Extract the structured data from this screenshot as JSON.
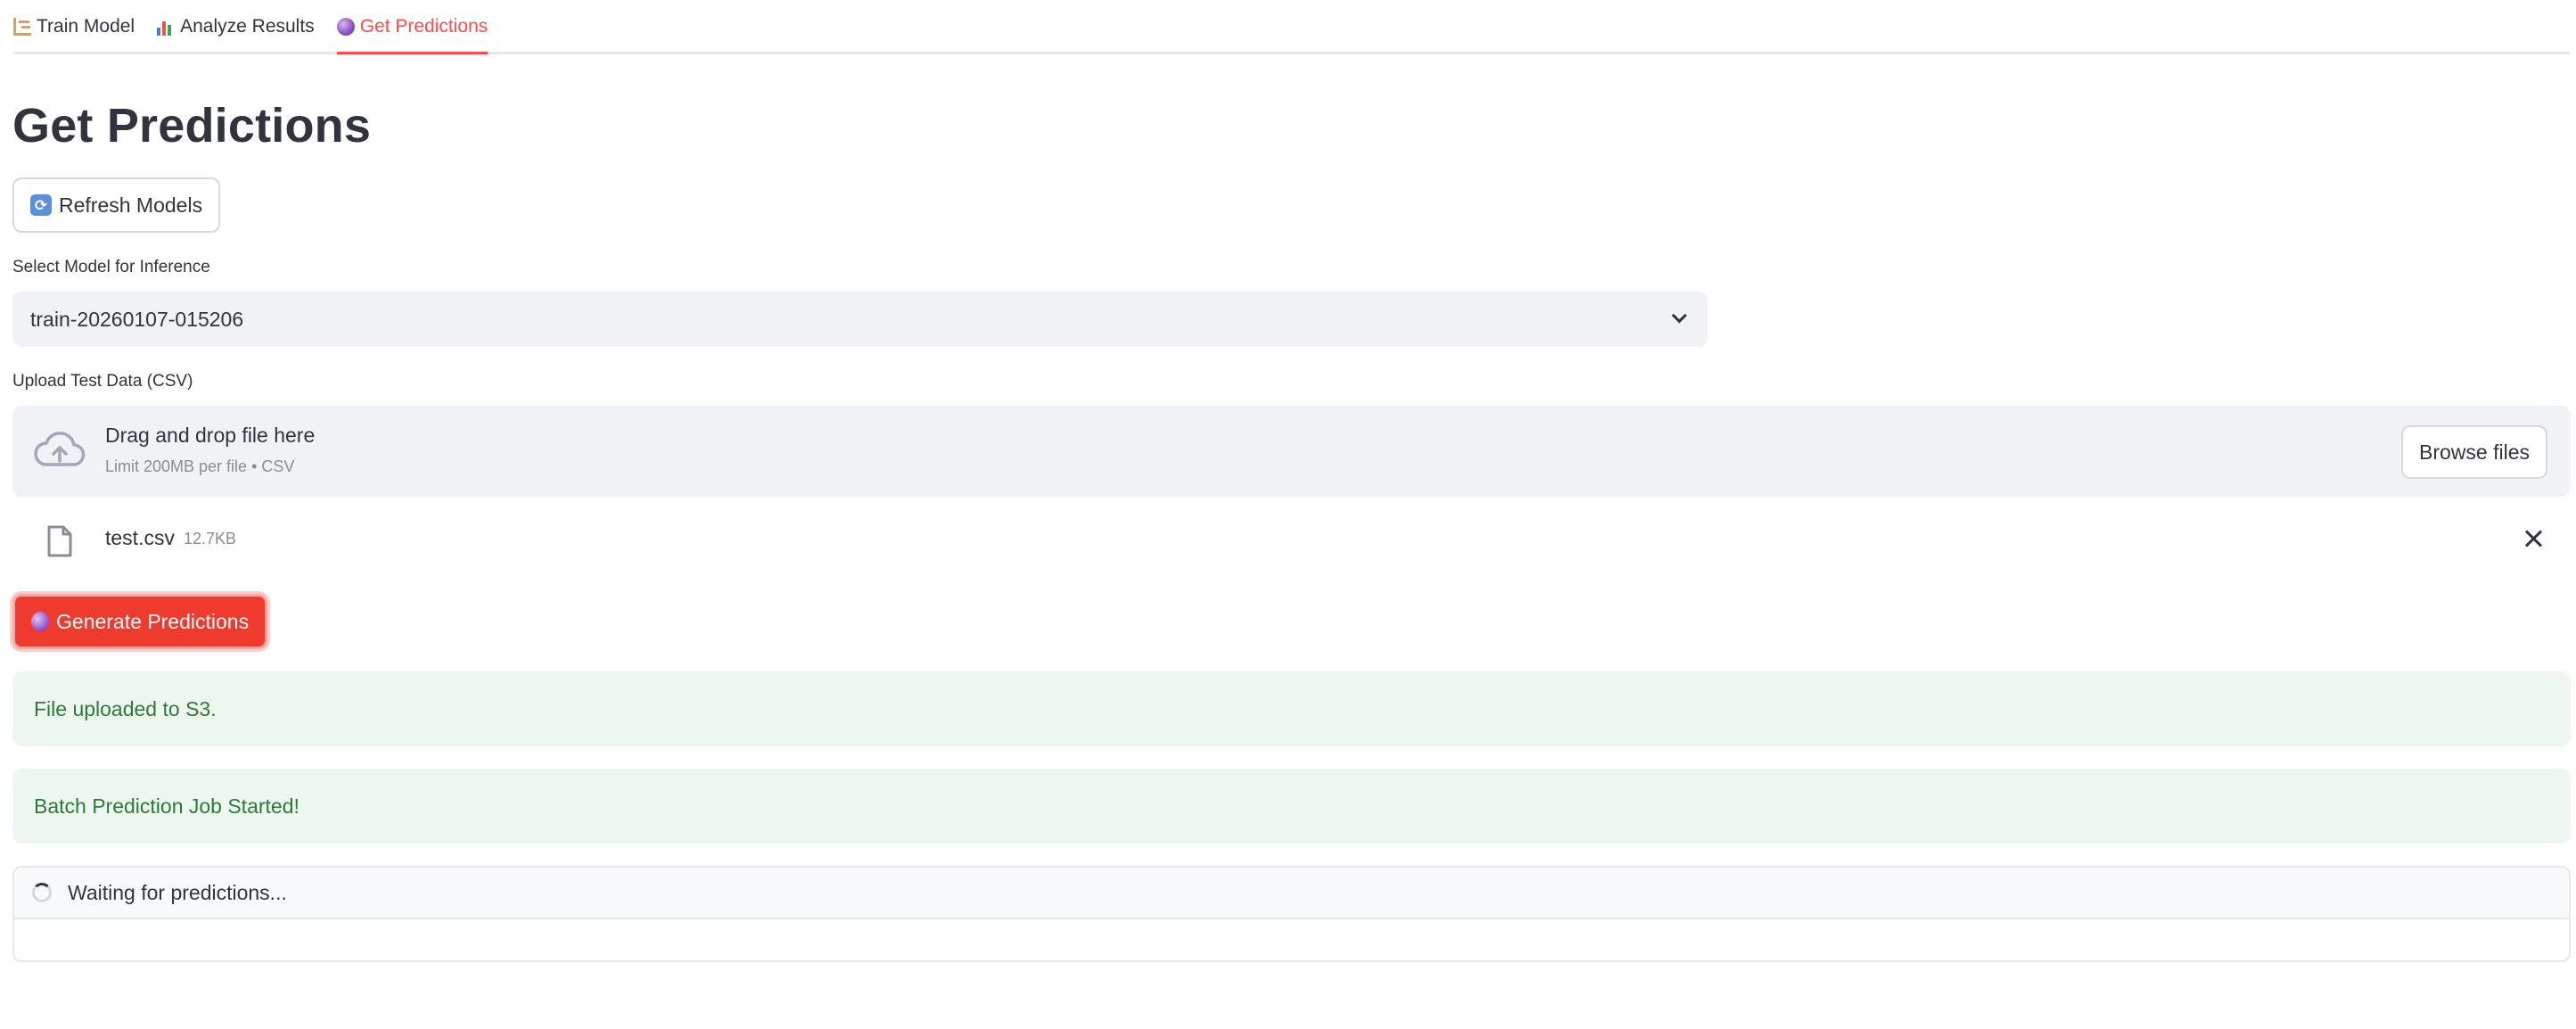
{
  "tabs": [
    {
      "label": "Train Model",
      "icon": "training-icon",
      "active": false
    },
    {
      "label": "Analyze Results",
      "icon": "bar-chart-icon",
      "active": false
    },
    {
      "label": "Get Predictions",
      "icon": "crystal-ball-icon",
      "active": true
    }
  ],
  "page": {
    "title": "Get Predictions"
  },
  "refresh_button": {
    "label": "Refresh Models",
    "icon": "refresh-icon"
  },
  "model_select": {
    "label": "Select Model for Inference",
    "value": "train-20260107-015206"
  },
  "uploader": {
    "label": "Upload Test Data (CSV)",
    "title": "Drag and drop file here",
    "subtitle": "Limit 200MB per file • CSV",
    "browse_label": "Browse files"
  },
  "uploaded_file": {
    "name": "test.csv",
    "size": "12.7KB"
  },
  "generate_button": {
    "label": "Generate Predictions",
    "icon": "crystal-ball-icon"
  },
  "alerts": [
    {
      "text": "File uploaded to S3."
    },
    {
      "text": "Batch Prediction Job Started!"
    }
  ],
  "status": {
    "text": "Waiting for predictions..."
  },
  "colors": {
    "accent": "#ff4b4b",
    "primary_button": "#ef3a2e",
    "success_bg": "#eef7ef",
    "success_text": "#2a7a3b"
  }
}
